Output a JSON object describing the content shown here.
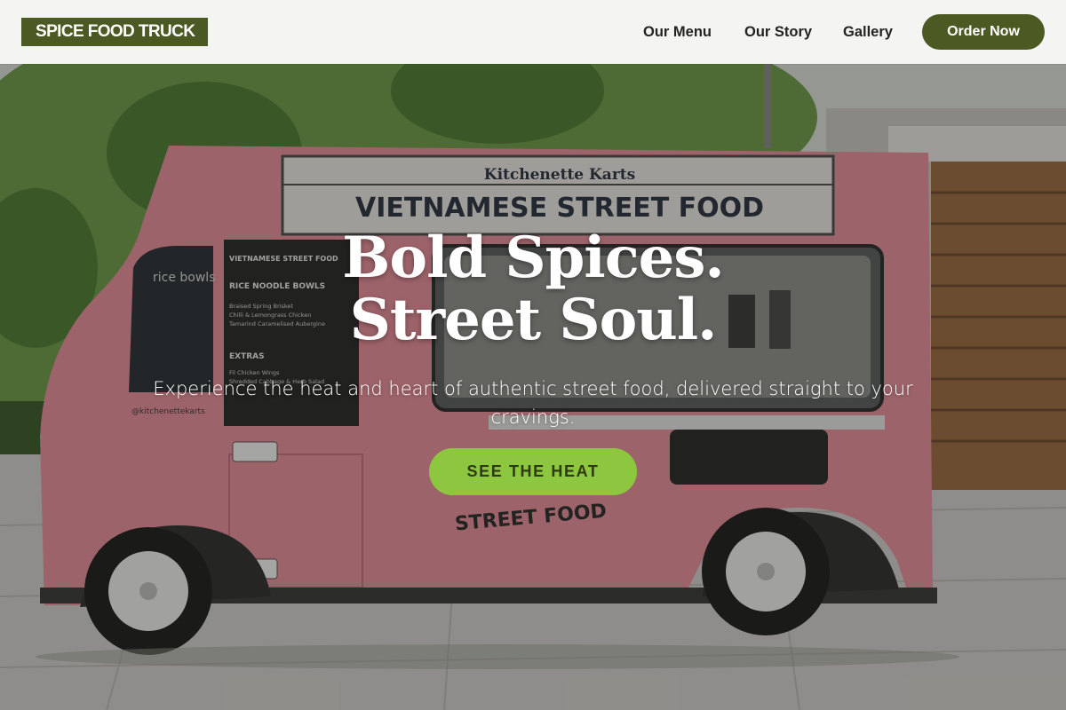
{
  "brand": {
    "logo_text": "SPICE FOOD TRUCK"
  },
  "nav": {
    "items": [
      {
        "label": "Our Menu"
      },
      {
        "label": "Our Story"
      },
      {
        "label": "Gallery"
      }
    ],
    "order_button": "Order Now"
  },
  "hero": {
    "headline_line1": "Bold Spices.",
    "headline_line2": "Street Soul.",
    "subtitle": "Experience the heat and heart of authentic street food, delivered straight to your cravings.",
    "cta_label": "SEE THE HEAT",
    "background": {
      "truck_brand": "Kitchenette Karts",
      "truck_sign": "VIETNAMESE STREET FOOD",
      "truck_handle": "@kitchenettekarts",
      "truck_slogan": "STREET FOOD",
      "window_text": "rice bowls",
      "menu_board": {
        "title": "VIETNAMESE STREET FOOD",
        "section1": "RICE NOODLE BOWLS",
        "items": [
          "Braised Spring Brisket",
          "Chilli & Lemongrass Chicken",
          "Tamarind Caramelised Aubergine"
        ],
        "section2": "EXTRAS",
        "extras": [
          "Fil Chicken Wings",
          "Shredded Cabbage & Herb Salad"
        ]
      }
    }
  },
  "colors": {
    "brand_green": "#4a5a22",
    "cta_green": "#8dc63f",
    "truck_pink": "#e58e9a"
  }
}
